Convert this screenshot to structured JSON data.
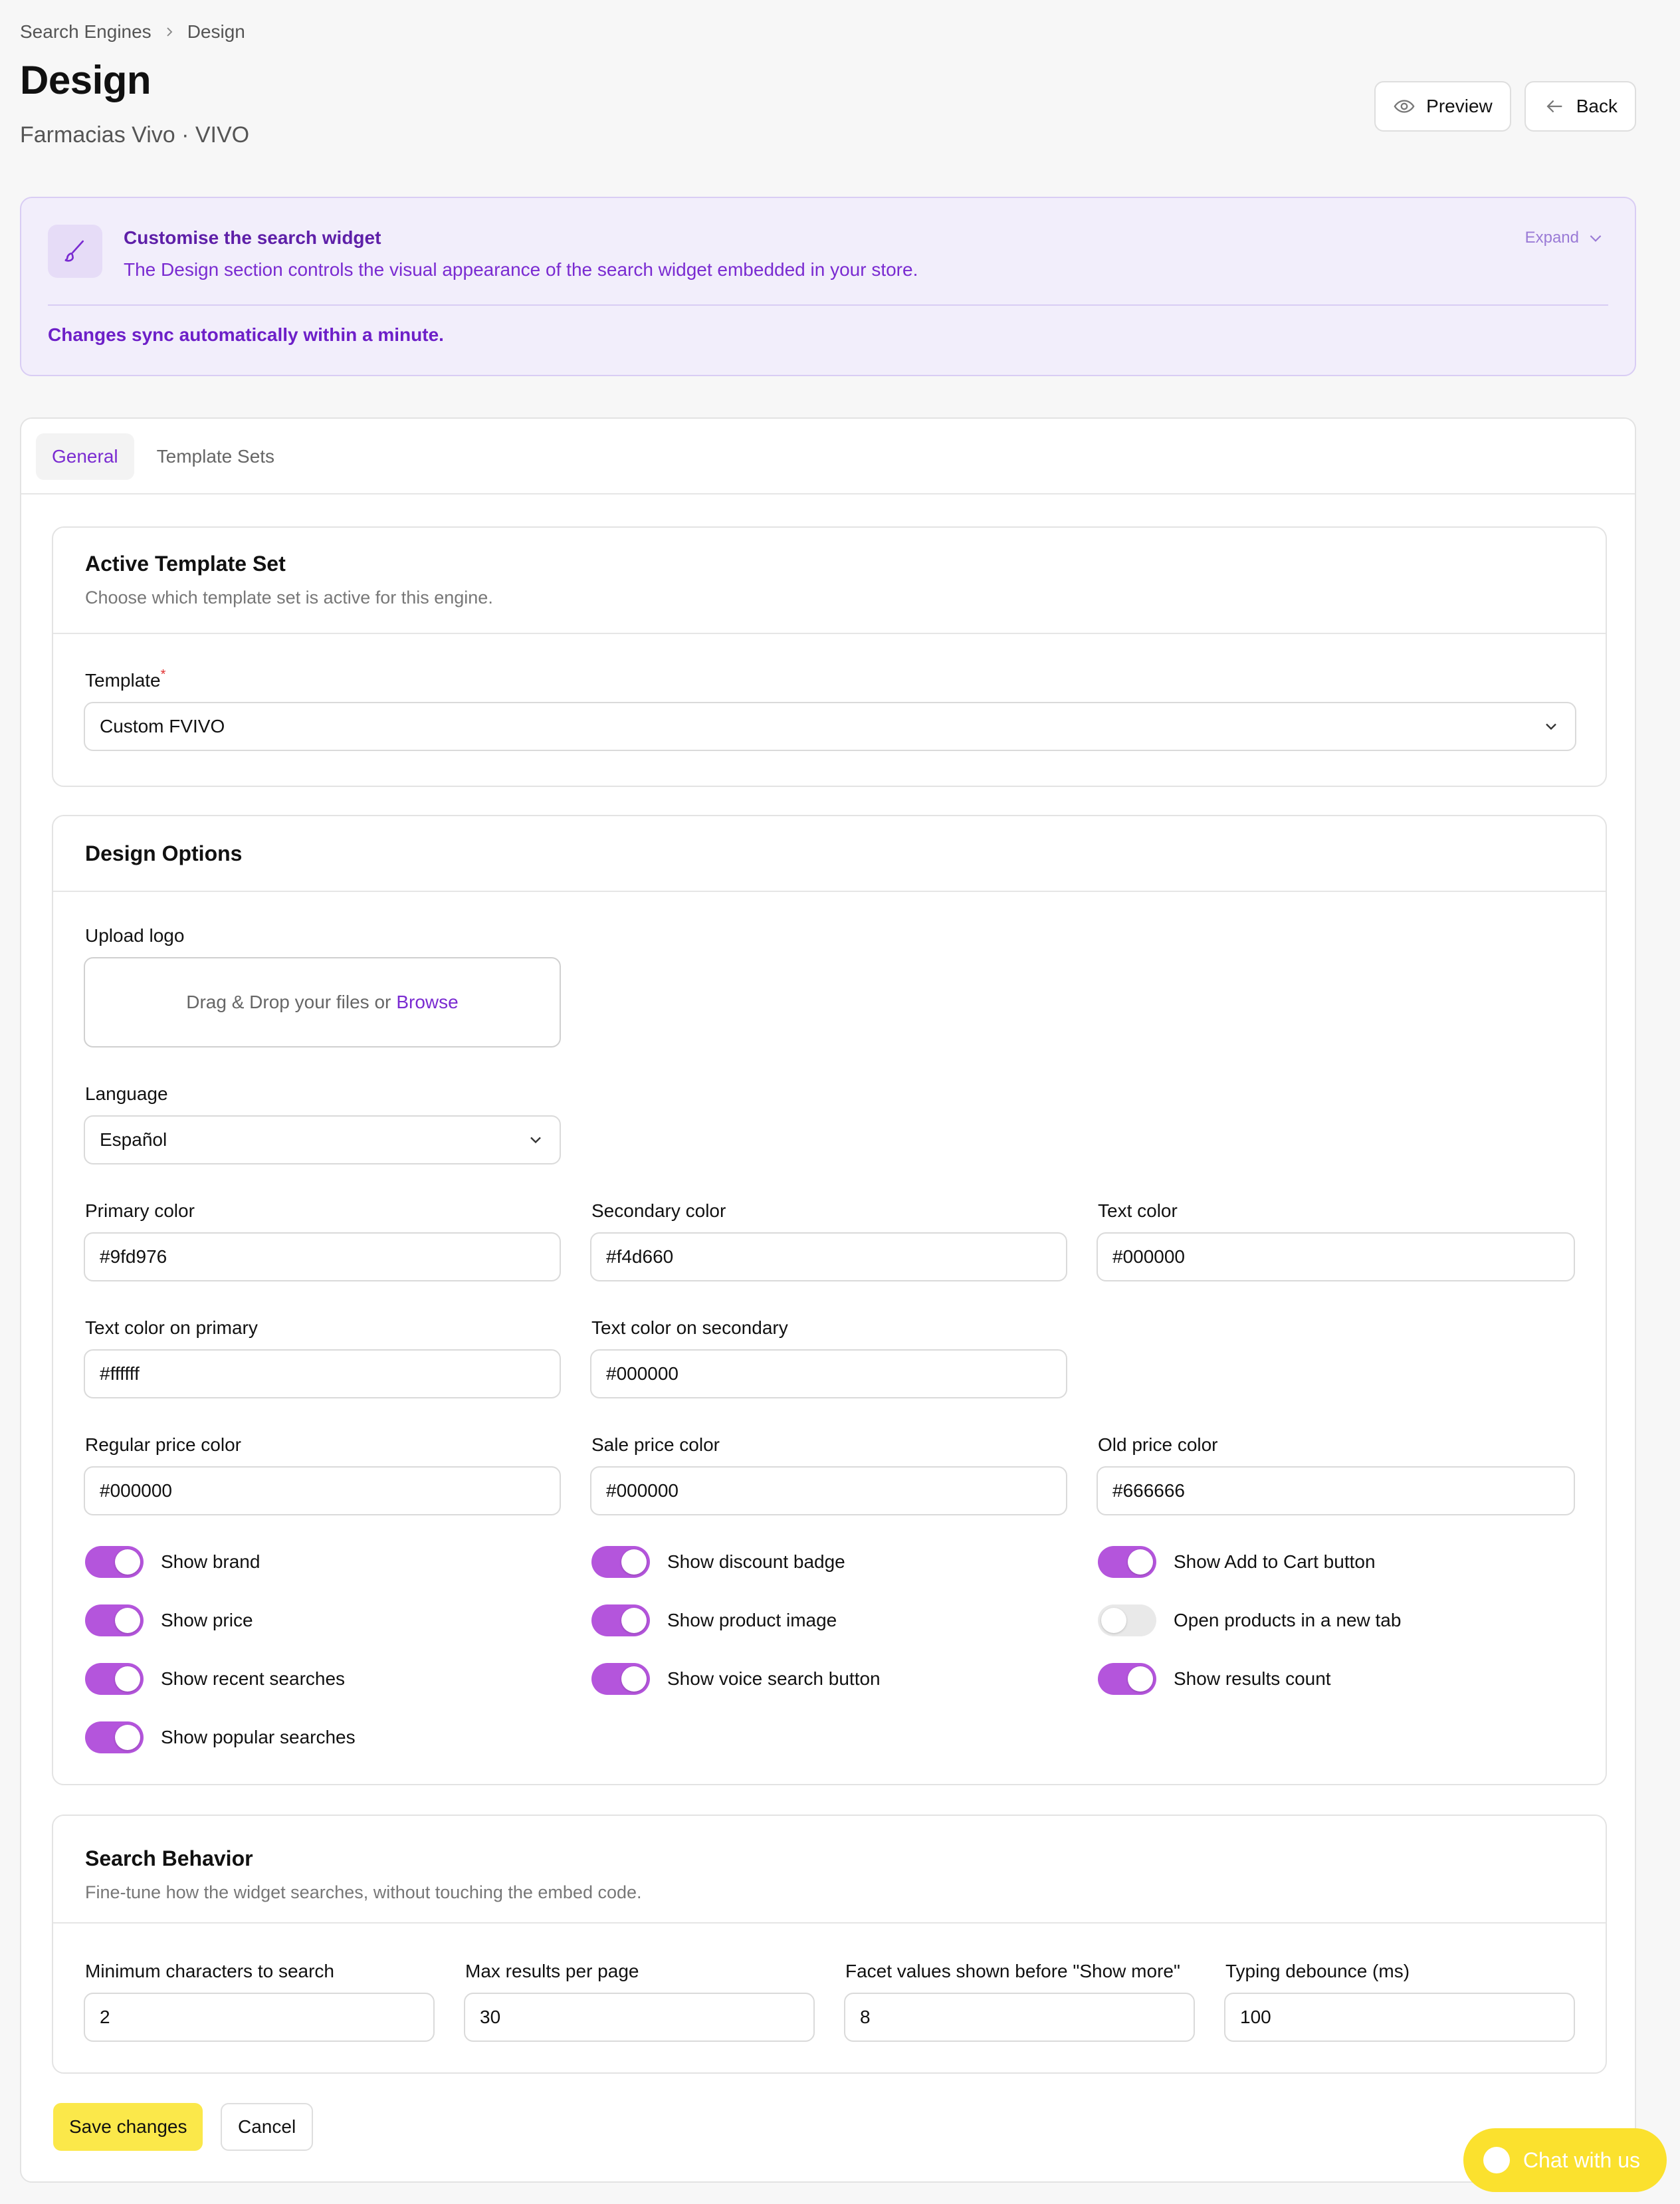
{
  "breadcrumb": {
    "parent": "Search Engines",
    "current": "Design"
  },
  "page": {
    "title": "Design",
    "subtitle": "Farmacias Vivo · VIVO"
  },
  "actions": {
    "preview": "Preview",
    "back": "Back"
  },
  "info": {
    "heading": "Customise the search widget",
    "description": "The Design section controls the visual appearance of the search widget embedded in your store.",
    "expand": "Expand",
    "sync_note": "Changes sync automatically within a minute."
  },
  "tabs": {
    "general": "General",
    "template_sets": "Template Sets"
  },
  "active_template": {
    "heading": "Active Template Set",
    "description": "Choose which template set is active for this engine.",
    "template_label": "Template",
    "required_mark": "*",
    "template_value": "Custom FVIVO"
  },
  "design_options": {
    "heading": "Design Options",
    "upload_label": "Upload logo",
    "upload_text": "Drag & Drop your files or",
    "upload_browse": "Browse",
    "language_label": "Language",
    "language_value": "Español",
    "colors": {
      "primary_label": "Primary color",
      "primary_value": "#9fd976",
      "secondary_label": "Secondary color",
      "secondary_value": "#f4d660",
      "text_label": "Text color",
      "text_value": "#000000",
      "text_on_primary_label": "Text color on primary",
      "text_on_primary_value": "#ffffff",
      "text_on_secondary_label": "Text color on secondary",
      "text_on_secondary_value": "#000000",
      "regular_price_label": "Regular price color",
      "regular_price_value": "#000000",
      "sale_price_label": "Sale price color",
      "sale_price_value": "#000000",
      "old_price_label": "Old price color",
      "old_price_value": "#666666"
    },
    "toggles": {
      "show_brand": {
        "label": "Show brand",
        "on": true
      },
      "show_discount_badge": {
        "label": "Show discount badge",
        "on": true
      },
      "show_add_to_cart": {
        "label": "Show Add to Cart button",
        "on": true
      },
      "show_price": {
        "label": "Show price",
        "on": true
      },
      "show_product_image": {
        "label": "Show product image",
        "on": true
      },
      "open_new_tab": {
        "label": "Open products in a new tab",
        "on": false
      },
      "show_recent_searches": {
        "label": "Show recent searches",
        "on": true
      },
      "show_voice_search": {
        "label": "Show voice search button",
        "on": true
      },
      "show_results_count": {
        "label": "Show results count",
        "on": true
      },
      "show_popular_searches": {
        "label": "Show popular searches",
        "on": true
      }
    }
  },
  "search_behavior": {
    "heading": "Search Behavior",
    "description": "Fine-tune how the widget searches, without touching the embed code.",
    "min_chars_label": "Minimum characters to search",
    "min_chars_value": "2",
    "max_results_label": "Max results per page",
    "max_results_value": "30",
    "facet_values_label": "Facet values shown before \"Show more\"",
    "facet_values_value": "8",
    "debounce_label": "Typing debounce (ms)",
    "debounce_value": "100"
  },
  "footer": {
    "save": "Save changes",
    "cancel": "Cancel"
  },
  "chat": {
    "label": "Chat with us"
  },
  "colors": {
    "accent": "#7a2bd1",
    "toggle_on": "#b455dc",
    "save_button": "#fbe84a",
    "chat_button": "#fbe12e"
  }
}
